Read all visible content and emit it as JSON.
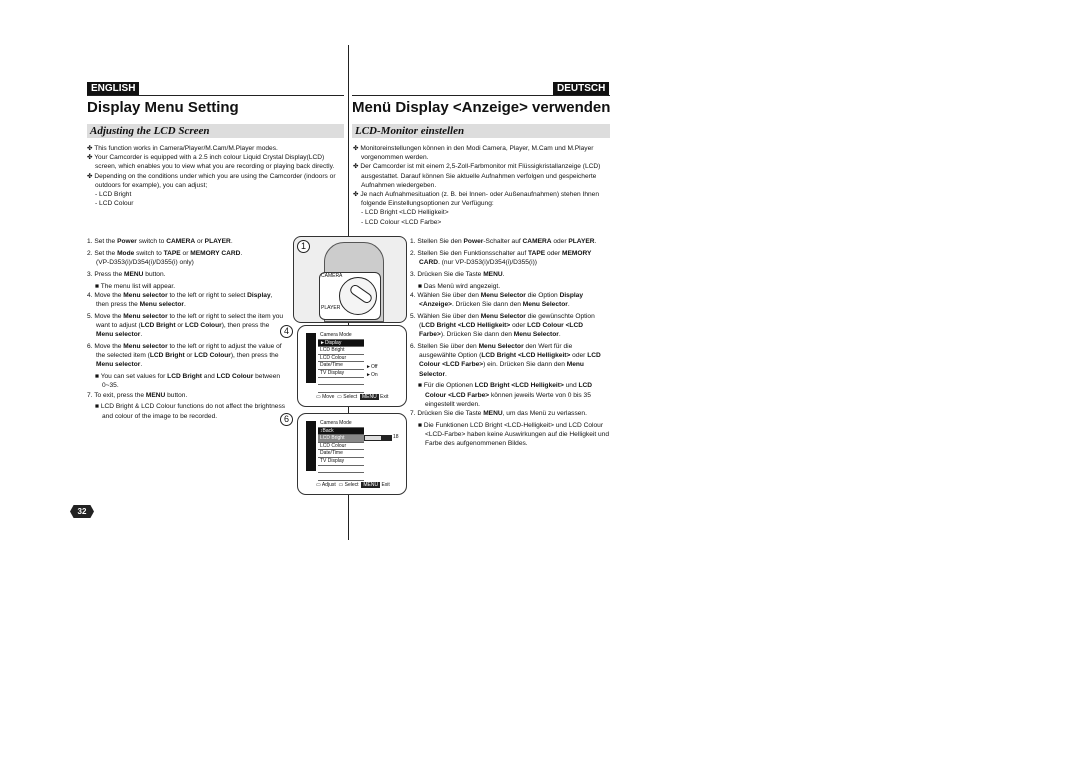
{
  "left": {
    "lang": "ENGLISH",
    "title": "Display Menu Setting",
    "section": "Adjusting the LCD Screen",
    "bullets": [
      "This function works in Camera/Player/M.Cam/M.Player modes.",
      "Your Camcorder is equipped with a 2.5 inch colour Liquid Crystal Display(LCD) screen, which enables you to view what you are recording or playing back directly.",
      "Depending on the conditions under which you are using the Camcorder (indoors or outdoors for example), you can adjust;"
    ],
    "options": [
      "- LCD Bright",
      "- LCD Colour"
    ],
    "steps": [
      "1. Set the <b>Power</b> switch to <b>CAMERA</b> or <b>PLAYER</b>.",
      "2. Set the <b>Mode</b> switch to <b>TAPE</b> or <b>MEMORY CARD</b>.<br>(VP-D353(i)/D354(i)/D355(i) only)",
      "3. Press the <b>MENU</b> button.<div class='sq'>■ The menu list will appear.</div>",
      "4. Move the <b>Menu selector</b> to the left or right to select <b>Display</b>, then press the <b>Menu selector</b>.",
      "5. Move the <b>Menu selector</b> to the left or right to select the item you want to adjust (<b>LCD Bright</b> or <b>LCD Colour</b>), then press the <b>Menu selector</b>.",
      "6. Move the <b>Menu selector</b> to the left or right to adjust the value of the selected item (<b>LCD Bright</b> or <b>LCD Colour</b>), then press the <b>Menu selector</b>.<div class='sq'>■ You can set values for <b>LCD Bright</b> and <b>LCD Colour</b> between 0~35.</div>",
      "7. To exit, press the <b>MENU</b> button.<div class='sq'>■ LCD Bright &amp; LCD Colour functions do not affect the brightness and colour of the image to be recorded.</div>"
    ]
  },
  "right": {
    "lang": "DEUTSCH",
    "title": "Menü Display <Anzeige> verwenden",
    "section": "LCD-Monitor einstellen",
    "bullets": [
      "Monitoreinstellungen können in den Modi Camera, Player, M.Cam und M.Player vorgenommen werden.",
      "Der Camcorder ist mit einem 2,5-Zoll-Farbmonitor mit Flüssigkristallanzeige (LCD) ausgestattet. Darauf können Sie aktuelle Aufnahmen verfolgen und gespeicherte Aufnahmen wiedergeben.",
      "Je nach Aufnahmesituation (z. B. bei Innen- oder Außenaufnahmen) stehen Ihnen folgende Einstellungsoptionen zur Verfügung:"
    ],
    "options": [
      "-  LCD Bright <LCD Helligkeit>",
      "-  LCD Colour <LCD Farbe>"
    ],
    "steps": [
      "1. Stellen Sie den <b>Power</b>-Schalter auf <b>CAMERA</b> oder <b>PLAYER</b>.",
      "2. Stellen Sie den Funktionsschalter auf <b>TAPE</b> oder <b>MEMORY CARD</b>. (nur VP-D353(i)/D354(i)/D355(i))",
      "3. Drücken Sie die Taste <b>MENU</b>.<div class='sq'>■ Das Menü wird angezeigt.</div>",
      "4. Wählen Sie über den <b>Menu Selector</b> die Option <b>Display &lt;Anzeige&gt;</b>. Drücken Sie dann den <b>Menu Selector</b>.",
      "5. Wählen Sie über den <b>Menu Selector</b> die gewünschte Option (<b>LCD Bright &lt;LCD Helligkeit&gt;</b> oder <b>LCD Colour &lt;LCD Farbe&gt;</b>). Drücken Sie dann den <b>Menu Selector</b>.",
      "6. Stellen Sie über den <b>Menu Selector</b> den Wert für die ausgewählte Option (<b>LCD Bright &lt;LCD Helligkeit&gt;</b> oder <b>LCD Colour &lt;LCD Farbe&gt;</b>) ein. Drücken Sie dann den <b>Menu Selector</b>.<div class='sq'>■ Für die Optionen <b>LCD Bright &lt;LCD Helligkeit&gt;</b> und <b>LCD Colour &lt;LCD Farbe&gt;</b> können jeweils Werte von 0 bis 35 eingestellt werden.</div>",
      "7. Drücken Sie die Taste <b>MENU</b>, um das Menü zu verlassen.<div class='sq'>■ Die Funktionen LCD Bright &lt;LCD-Helligkeit&gt; und LCD Colour &lt;LCD-Farbe&gt; haben keine Auswirkungen auf die Helligkeit und Farbe des aufgenommenen Bildes.</div>"
    ]
  },
  "figures": {
    "fig1": {
      "num": "1",
      "camera": "CAMERA",
      "player": "PLAYER"
    },
    "fig4": {
      "num": "4",
      "mode": "Camera Mode",
      "items": [
        "►Display",
        "LCD Bright",
        "LCD Colour",
        "Date/Time",
        "TV Display"
      ],
      "values": [
        "►Off",
        "►On"
      ],
      "footer": [
        "Move",
        "Select",
        "MENU",
        "Exit"
      ]
    },
    "fig6": {
      "num": "6",
      "mode": "Camera Mode",
      "items": [
        "↕Back",
        "LCD Bright",
        "LCD Colour",
        "Date/Time",
        "TV Display"
      ],
      "slider_value": "18",
      "slider_fraction": 0.51,
      "footer": [
        "Adjust",
        "Select",
        "MENU",
        "Exit"
      ]
    }
  },
  "page_number": "32"
}
